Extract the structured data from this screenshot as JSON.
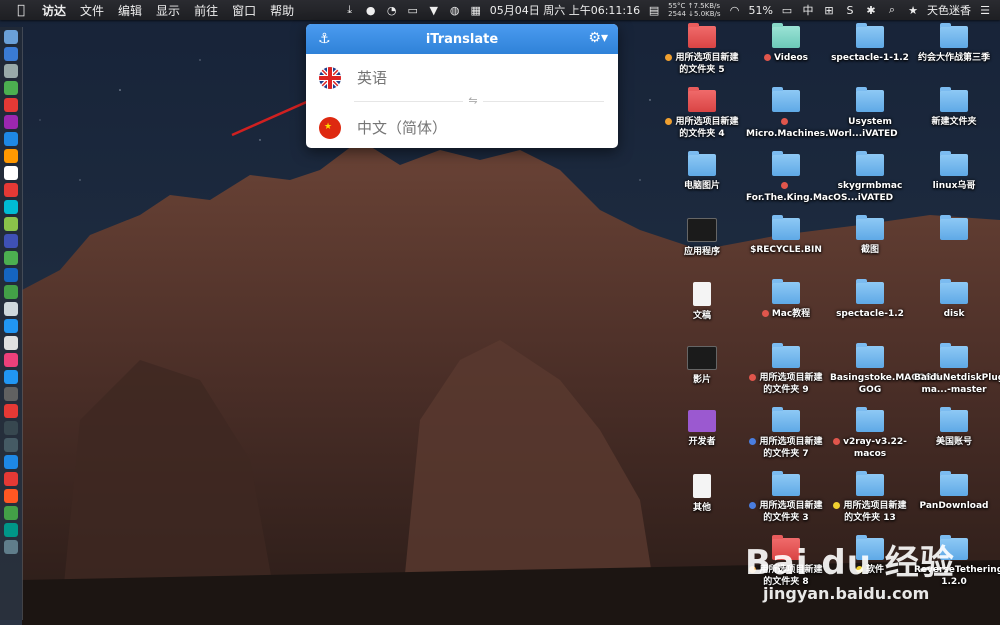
{
  "menubar": {
    "apple": "",
    "items": [
      "访达",
      "文件",
      "编辑",
      "显示",
      "前往",
      "窗口",
      "帮助"
    ],
    "netspeed": {
      "line1": "55°C ↑7.5KB/s",
      "line2": "2544 ↓5.0KB/s"
    },
    "datetime": "05月04日 周六 上午06:11:16",
    "battery": "51%",
    "input_method": "中",
    "username": "天色迷香"
  },
  "popup": {
    "title": "iTranslate",
    "source_placeholder": "英语",
    "target_placeholder": "中文（简体）",
    "swap_symbol": "⇋"
  },
  "desktop": {
    "icons": [
      {
        "label": "用所选项目新建的文件夹 5",
        "kind": "red",
        "dot": "#f0a030"
      },
      {
        "label": "Videos",
        "kind": "teal",
        "dot": "#e0564c"
      },
      {
        "label": "spectacle-1-1.2",
        "kind": "folder",
        "dot": ""
      },
      {
        "label": "约会大作战第三季",
        "kind": "folder",
        "dot": ""
      },
      {
        "label": "用所选项目新建的文件夹 4",
        "kind": "red",
        "dot": "#f0a030"
      },
      {
        "label": "Micro.Machines.Worl...iVATED",
        "kind": "folder",
        "dot": "#e0564c"
      },
      {
        "label": "Usystem",
        "kind": "folder",
        "dot": ""
      },
      {
        "label": "新建文件夹",
        "kind": "folder",
        "dot": ""
      },
      {
        "label": "电脑图片",
        "kind": "folder",
        "dot": ""
      },
      {
        "label": "For.The.King.MacOS...iVATED",
        "kind": "folder",
        "dot": "#e0564c"
      },
      {
        "label": "skygrmbmac",
        "kind": "folder",
        "dot": ""
      },
      {
        "label": "linux乌哥",
        "kind": "folder",
        "dot": ""
      },
      {
        "label": "应用程序",
        "kind": "dark",
        "dot": ""
      },
      {
        "label": "$RECYCLE.BIN",
        "kind": "folder",
        "dot": ""
      },
      {
        "label": "截图",
        "kind": "folder",
        "dot": ""
      },
      {
        "label": "",
        "kind": "folder",
        "dot": ""
      },
      {
        "label": "文稿",
        "kind": "doc",
        "dot": ""
      },
      {
        "label": "Mac教程",
        "kind": "folder",
        "dot": "#e0564c"
      },
      {
        "label": "spectacle-1.2",
        "kind": "folder",
        "dot": ""
      },
      {
        "label": "disk",
        "kind": "folder",
        "dot": ""
      },
      {
        "label": "影片",
        "kind": "dark",
        "dot": ""
      },
      {
        "label": "用所选项目新建的文件夹 9",
        "kind": "folder",
        "dot": "#e0564c"
      },
      {
        "label": "Basingstoke.MACOSX-GOG",
        "kind": "folder",
        "dot": ""
      },
      {
        "label": "BaiduNetdiskPlugin-ma...-master",
        "kind": "folder",
        "dot": ""
      },
      {
        "label": "开发者",
        "kind": "purple",
        "dot": ""
      },
      {
        "label": "用所选项目新建的文件夹 7",
        "kind": "folder",
        "dot": "#4a7ee0"
      },
      {
        "label": "v2ray-v3.22-macos",
        "kind": "folder",
        "dot": "#e0564c"
      },
      {
        "label": "美国账号",
        "kind": "folder",
        "dot": ""
      },
      {
        "label": "其他",
        "kind": "doc",
        "dot": ""
      },
      {
        "label": "用所选项目新建的文件夹 3",
        "kind": "folder",
        "dot": "#4a7ee0"
      },
      {
        "label": "用所选项目新建的文件夹 13",
        "kind": "folder",
        "dot": "#f0d030"
      },
      {
        "label": "PanDownload",
        "kind": "folder",
        "dot": ""
      },
      {
        "label": "",
        "kind": "none",
        "dot": ""
      },
      {
        "label": "用所选项目新建的文件夹 8",
        "kind": "red",
        "dot": "#f0a030"
      },
      {
        "label": "软件",
        "kind": "folder",
        "dot": "#f0d030"
      },
      {
        "label": "ReverseTetheringServer-1.2.0",
        "kind": "folder",
        "dot": ""
      }
    ]
  },
  "watermark": {
    "big": "Bai du 经验",
    "small": "jingyan.baidu.com"
  },
  "colors": {
    "accent": "#3d8fe0",
    "folder": "#6db5ee"
  }
}
